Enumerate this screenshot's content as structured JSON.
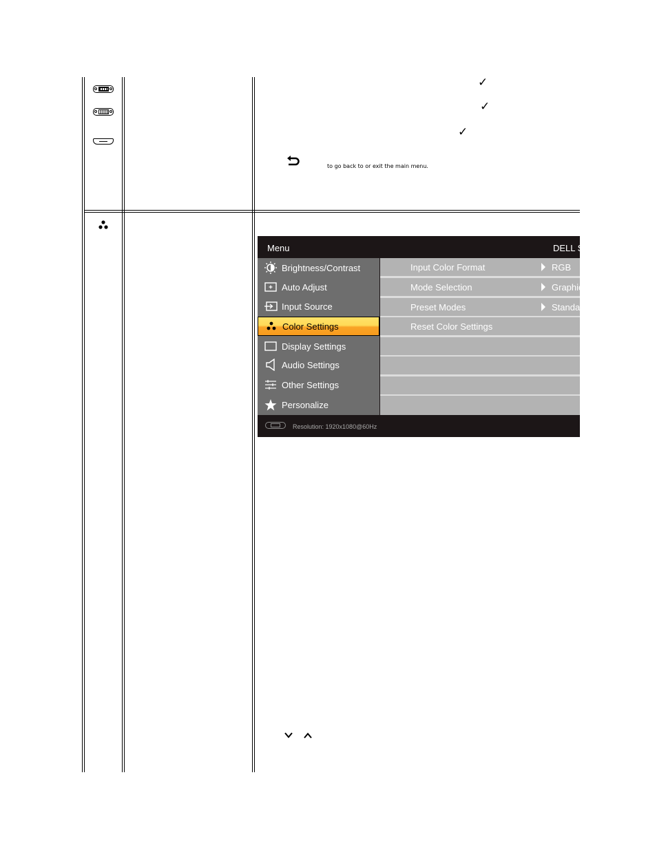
{
  "table": {
    "row1": {
      "input_icons": [
        "vga-connector-icon",
        "dvi-connector-icon",
        "hdmi-connector-icon"
      ],
      "checkmarks": [
        "✓",
        "✓",
        "✓"
      ],
      "back_icon": "back-arrow-icon",
      "back_text": "to go back to or exit the main menu."
    },
    "row2": {
      "icon": "color-settings-icon",
      "nav_icons": [
        "down-chevron-icon",
        "up-chevron-icon"
      ],
      "nav_glyphs": [
        "⌄",
        "⌃"
      ]
    }
  },
  "osd": {
    "title": "Menu",
    "brand": "DELL S",
    "menu_items": [
      {
        "label": "Brightness/Contrast",
        "icon": "brightness-icon",
        "active": false
      },
      {
        "label": "Auto Adjust",
        "icon": "auto-adjust-icon",
        "active": false
      },
      {
        "label": "Input Source",
        "icon": "input-source-icon",
        "active": false
      },
      {
        "label": "Color Settings",
        "icon": "color-settings-icon",
        "active": true
      },
      {
        "label": "Display Settings",
        "icon": "display-settings-icon",
        "active": false
      },
      {
        "label": "Audio Settings",
        "icon": "audio-settings-icon",
        "active": false
      },
      {
        "label": "Other Settings",
        "icon": "other-settings-icon",
        "active": false
      },
      {
        "label": "Personalize",
        "icon": "star-icon",
        "active": false
      }
    ],
    "submenu": [
      {
        "label": "Input Color Format",
        "value": "RGB"
      },
      {
        "label": "Mode Selection",
        "value": "Graphic"
      },
      {
        "label": "Preset Modes",
        "value": "Standa"
      },
      {
        "label": "Reset Color Settings",
        "value": ""
      },
      {
        "label": "",
        "value": ""
      },
      {
        "label": "",
        "value": ""
      },
      {
        "label": "",
        "value": ""
      },
      {
        "label": "",
        "value": ""
      }
    ],
    "footer": {
      "resolution_text": "Resolution:  1920x1080@60Hz"
    },
    "colors": {
      "background": "#1c1617",
      "left_panel": "#6e6e6e",
      "right_panel": "#b3b3b3",
      "active_top": "#ffe36a",
      "active_bottom": "#f79b1d"
    }
  }
}
